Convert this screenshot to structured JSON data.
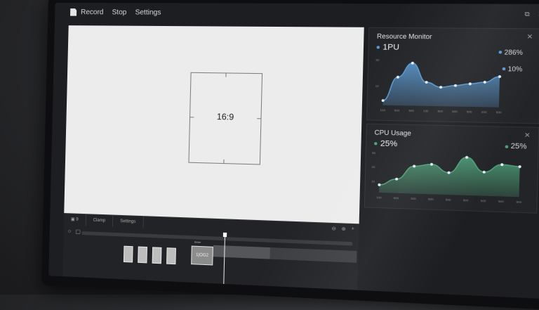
{
  "menu": {
    "record": "Record",
    "stop": "Stop",
    "settings": "Settings"
  },
  "window_controls": {
    "restore": "⧉",
    "close": "✕"
  },
  "canvas": {
    "aspect_label": "16:9"
  },
  "timeline": {
    "tab_count": "9",
    "tab_clamp": "Clamp",
    "tab_settings": "Settings",
    "clip_label": "1|OG2",
    "clip_header": "timer",
    "progress_fraction": 0.4
  },
  "resource_monitor": {
    "title": "Resource Monitor",
    "metric": "1PU",
    "value_a": "286%",
    "value_b": "10%",
    "close_icon": "✕",
    "color": "#5a9bd5",
    "y_ticks": [
      "50",
      "10"
    ],
    "x_ticks": [
      "100",
      "500",
      "500",
      "130",
      "500",
      "500",
      "500",
      "200",
      "500"
    ]
  },
  "cpu_usage": {
    "title": "CPU Usage",
    "metric": "25%",
    "value_a": "25%",
    "close_icon": "✕",
    "color": "#4fa37a",
    "y_ticks": [
      "50",
      "20",
      "10"
    ],
    "x_ticks": [
      "100",
      "500",
      "500",
      "500",
      "500",
      "500",
      "500",
      "500",
      "500"
    ]
  },
  "chart_data": [
    {
      "type": "area",
      "title": "Resource Monitor",
      "x": [
        0,
        1,
        2,
        3,
        4,
        5,
        6,
        7,
        8
      ],
      "values": [
        5,
        30,
        45,
        25,
        20,
        22,
        24,
        26,
        32
      ],
      "ylim": [
        0,
        55
      ]
    },
    {
      "type": "area",
      "title": "CPU Usage",
      "x": [
        0,
        1,
        2,
        3,
        4,
        5,
        6,
        7,
        8
      ],
      "values": [
        10,
        18,
        35,
        38,
        28,
        48,
        30,
        40,
        38
      ],
      "ylim": [
        0,
        55
      ]
    }
  ]
}
